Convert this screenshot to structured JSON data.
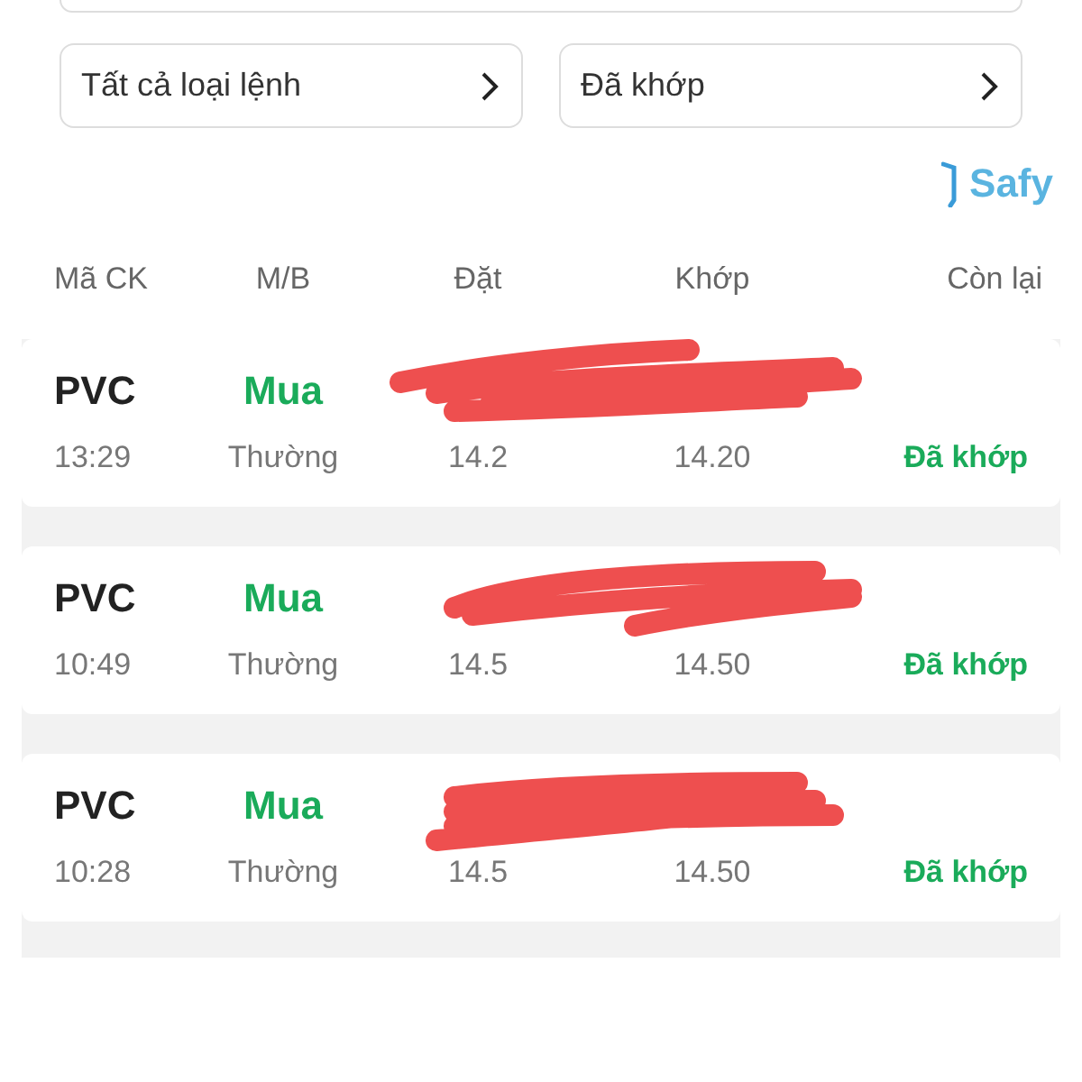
{
  "filters": [
    {
      "label": "Tất cả loại lệnh"
    },
    {
      "label": "Đã khớp"
    }
  ],
  "logo": {
    "text": "Safy"
  },
  "table": {
    "columns": [
      "Mã CK",
      "M/B",
      "Đặt",
      "Khớp",
      "Còn lại"
    ],
    "rows": [
      {
        "symbol": "PVC",
        "side": "Mua",
        "time": "13:29",
        "order_type": "Thường",
        "price": "14.2",
        "matched": "14.20",
        "status": "Đã khớp",
        "redacted": true
      },
      {
        "symbol": "PVC",
        "side": "Mua",
        "time": "10:49",
        "order_type": "Thường",
        "price": "14.5",
        "matched": "14.50",
        "status": "Đã khớp",
        "redacted": true
      },
      {
        "symbol": "PVC",
        "side": "Mua",
        "time": "10:28",
        "order_type": "Thường",
        "price": "14.5",
        "matched": "14.50",
        "status": "Đã khớp",
        "redacted": true
      }
    ]
  }
}
